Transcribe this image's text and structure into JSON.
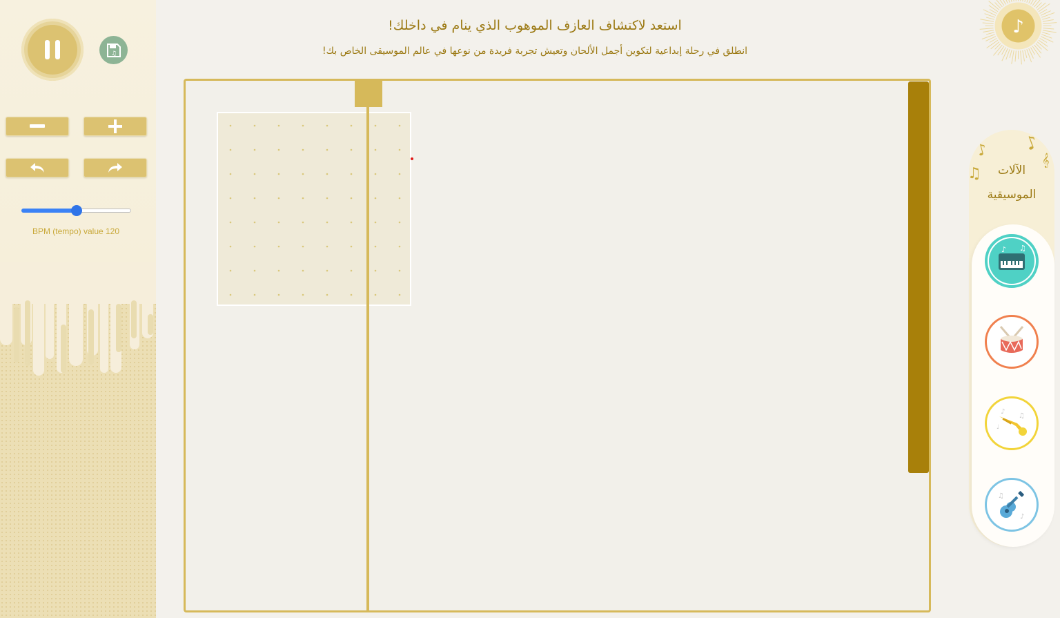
{
  "header": {
    "title": "استعد لاكتشاف العازف الموهوب الذي ينام في داخلك!",
    "subtitle": "انطلق في رحلة إبداعية لتكوين أجمل الألحان وتعيش تجربة فريدة من نوعها في عالم الموسيقى الخاص بك!"
  },
  "controls": {
    "play_state": "paused",
    "pause_icon": "pause-icon",
    "save_icon": "save-icon",
    "zoom_out_icon": "minus-icon",
    "zoom_in_icon": "plus-icon",
    "undo_icon": "undo-arrow-icon",
    "redo_icon": "redo-arrow-icon"
  },
  "tempo": {
    "label": "BPM (tempo) value 120",
    "value": 120,
    "fraction": 0.5
  },
  "instruments": {
    "title": "الآلات الموسيقية",
    "items": [
      {
        "name": "piano",
        "icon": "piano-icon",
        "color": "#4fd1c5",
        "selected": true
      },
      {
        "name": "drum",
        "icon": "drum-icon",
        "color": "#f0804e",
        "selected": false
      },
      {
        "name": "trumpet",
        "icon": "trumpet-icon",
        "color": "#f2d43a",
        "selected": false
      },
      {
        "name": "guitar",
        "icon": "guitar-icon",
        "color": "#7dc4e4",
        "selected": false
      }
    ]
  },
  "colors": {
    "accent": "#d6b95a",
    "accent_dark": "#a8800a",
    "text": "#9c7a14",
    "slider": "#3b82f6"
  }
}
